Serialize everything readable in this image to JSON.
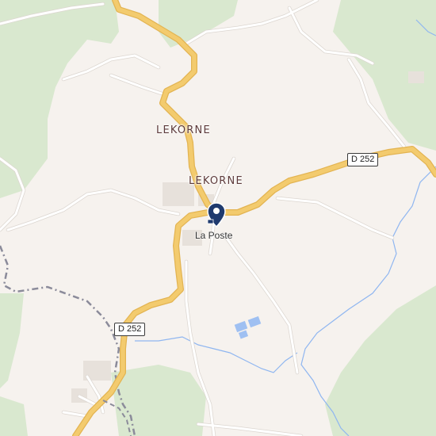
{
  "map": {
    "colors": {
      "background": "#f6f2ee",
      "forest": "#d9e8cf",
      "forest_dark": "#cfe2c3",
      "major_road": "#f3cb6e",
      "major_road_casing": "#e3b452",
      "minor_road": "#ffffff",
      "minor_road_casing": "#dcd6d0",
      "water": "#8fb6f0",
      "boundary": "#8b8b9a",
      "place_label": "#5d3a3a",
      "pin": "#1f3a6e"
    },
    "places": [
      {
        "name": "LEKORNE"
      },
      {
        "name": "LEKORNE"
      }
    ],
    "road_shields": [
      {
        "ref": "D 252"
      },
      {
        "ref": "D 252"
      }
    ],
    "poi": {
      "name": "La Poste",
      "icon": "post-office-icon"
    }
  }
}
